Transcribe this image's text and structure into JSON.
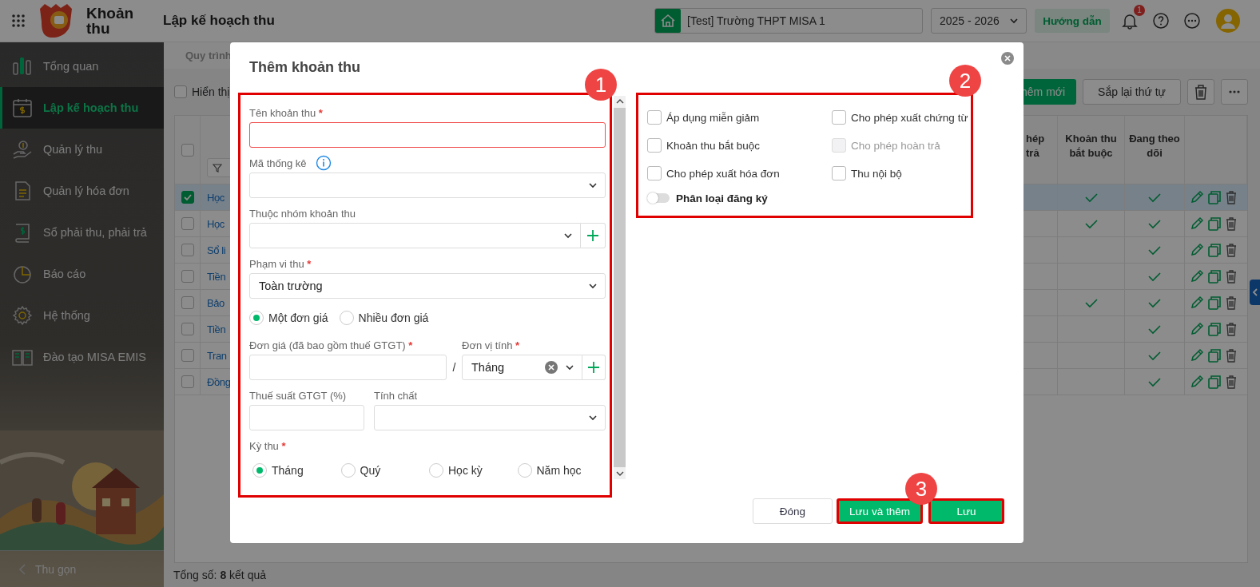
{
  "topbar": {
    "app_name": "Khoản thu",
    "page_title": "Lập kế hoạch thu",
    "school": "[Test] Trường THPT MISA 1",
    "school_year": "2025 - 2026",
    "help_button": "Hướng dẫn",
    "notification_count": "1"
  },
  "sidebar": {
    "items": [
      {
        "label": "Tổng quan",
        "selected": false
      },
      {
        "label": "Lập kế hoạch thu",
        "selected": true
      },
      {
        "label": "Quản lý thu",
        "selected": false
      },
      {
        "label": "Quản lý hóa đơn",
        "selected": false
      },
      {
        "label": "Sổ phải thu, phải trả",
        "selected": false
      },
      {
        "label": "Báo cáo",
        "selected": false
      },
      {
        "label": "Hệ thống",
        "selected": false
      },
      {
        "label": "Đào tạo MISA EMIS",
        "selected": false
      }
    ],
    "collapse_label": "Thu gọn"
  },
  "page": {
    "tab": "Quy trình",
    "show_option": {
      "label": "Hiển thị",
      "checked": false
    },
    "add_button": "hêm mới",
    "reorder_button": "Sắp lại thứ tự",
    "table": {
      "all_checked": false,
      "columns": [
        {
          "label": "hép trả"
        },
        {
          "label": "Khoản thu bắt buộc"
        },
        {
          "label": "Đang theo dõi"
        }
      ],
      "rows": [
        {
          "name": "Học",
          "selected": true,
          "required": true,
          "tracking": true
        },
        {
          "name": "Học",
          "selected": false,
          "required": true,
          "tracking": true
        },
        {
          "name": "Sổ li",
          "selected": false,
          "required": false,
          "tracking": true
        },
        {
          "name": "Tiền",
          "selected": false,
          "required": false,
          "tracking": true
        },
        {
          "name": "Bảo",
          "selected": false,
          "required": true,
          "tracking": true
        },
        {
          "name": "Tiền",
          "selected": false,
          "required": false,
          "tracking": true
        },
        {
          "name": "Tran",
          "selected": false,
          "required": false,
          "tracking": true
        },
        {
          "name": "Đồng",
          "selected": false,
          "required": false,
          "tracking": true
        }
      ]
    },
    "total": "Tổng số: **8** kết quả"
  },
  "dialog": {
    "title": "Thêm khoản thu",
    "required_mark": "*",
    "fields": [
      {
        "kind": "text",
        "label": "Tên khoản thu",
        "required": true,
        "invalid": true
      },
      {
        "kind": "select",
        "label": "Mã thống kê",
        "required": false,
        "info": true
      },
      {
        "kind": "select",
        "label": "Thuộc nhóm khoản thu",
        "required": false,
        "addable": true
      },
      {
        "kind": "select",
        "label": "Phạm vi thu",
        "required": true,
        "value": "Toàn trường"
      },
      {
        "kind": "radios",
        "options": [
          {
            "label": "Một đơn giá",
            "selected": true
          },
          {
            "label": "Nhiều đơn giá",
            "selected": false
          }
        ]
      },
      {
        "kind": "price_row",
        "items": [
          {
            "kind": "text",
            "label": "Đơn giá (đã bao gồm thuế GTGT)",
            "required": true,
            "invalid": false
          },
          {
            "kind": "separator",
            "text": "/"
          },
          {
            "kind": "select",
            "label": "Đơn vị tính",
            "required": true,
            "value": "Tháng",
            "clearable": true,
            "addable": true
          }
        ]
      },
      {
        "kind": "pair_row",
        "items": [
          {
            "kind": "text",
            "label": "Thuế suất GTGT (%)",
            "required": false,
            "invalid": false
          },
          {
            "kind": "select",
            "label": "Tính chất",
            "required": false
          }
        ]
      },
      {
        "kind": "radios",
        "label": "Kỳ thu",
        "required": true,
        "options": [
          {
            "label": "Tháng",
            "selected": true
          },
          {
            "label": "Quý",
            "selected": false
          },
          {
            "label": "Học kỳ",
            "selected": false
          },
          {
            "label": "Năm học",
            "selected": false
          }
        ]
      }
    ],
    "options": [
      {
        "kind": "checkbox",
        "label": "Áp dụng miễn giảm",
        "checked": false,
        "disabled": false
      },
      {
        "kind": "checkbox",
        "label": "Cho phép xuất chứng từ",
        "checked": false,
        "disabled": false
      },
      {
        "kind": "checkbox",
        "label": "Khoản thu bắt buộc",
        "checked": false,
        "disabled": false
      },
      {
        "kind": "checkbox",
        "label": "Cho phép hoàn trả",
        "checked": false,
        "disabled": true
      },
      {
        "kind": "checkbox",
        "label": "Cho phép xuất hóa đơn",
        "checked": false,
        "disabled": false
      },
      {
        "kind": "checkbox",
        "label": "Thu nội bộ",
        "checked": false,
        "disabled": false
      },
      {
        "kind": "toggle",
        "label": "Phân loại đăng ký",
        "on": false
      }
    ],
    "buttons": [
      {
        "label": "Đóng",
        "primary": false,
        "highlighted": false
      },
      {
        "label": "Lưu và thêm",
        "primary": true,
        "highlighted": true
      },
      {
        "label": "Lưu",
        "primary": true,
        "highlighted": true
      }
    ],
    "callouts": [
      "1",
      "2",
      "3"
    ]
  }
}
